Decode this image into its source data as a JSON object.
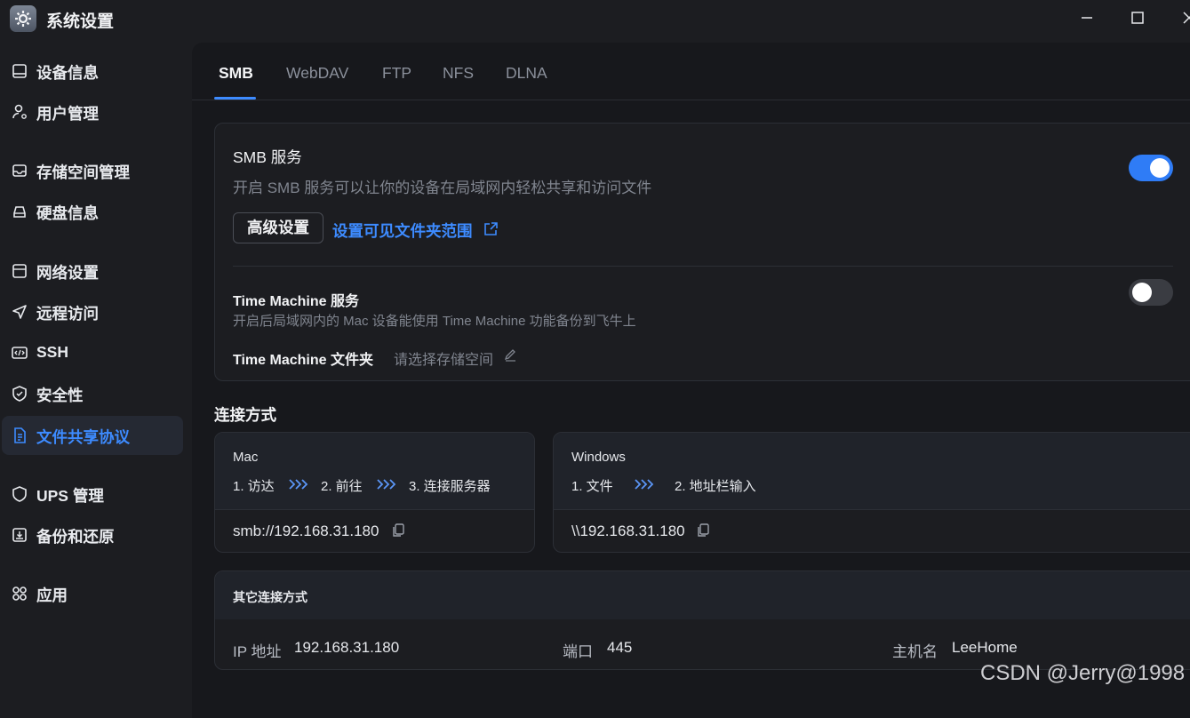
{
  "window": {
    "title": "系统设置"
  },
  "sidebar": {
    "items": [
      {
        "label": "设备信息",
        "icon": "device-info-icon"
      },
      {
        "label": "用户管理",
        "icon": "user-icon"
      },
      {
        "label": "存储空间管理",
        "icon": "storage-icon"
      },
      {
        "label": "硬盘信息",
        "icon": "disk-icon"
      },
      {
        "label": "网络设置",
        "icon": "network-icon"
      },
      {
        "label": "远程访问",
        "icon": "send-icon"
      },
      {
        "label": "SSH",
        "icon": "code-icon"
      },
      {
        "label": "安全性",
        "icon": "shield-check-icon"
      },
      {
        "label": "文件共享协议",
        "icon": "document-icon",
        "active": true
      },
      {
        "label": "UPS 管理",
        "icon": "shield-icon"
      },
      {
        "label": "备份和还原",
        "icon": "backup-icon"
      },
      {
        "label": "应用",
        "icon": "apps-icon"
      }
    ]
  },
  "tabs": [
    {
      "label": "SMB",
      "active": true
    },
    {
      "label": "WebDAV"
    },
    {
      "label": "FTP"
    },
    {
      "label": "NFS"
    },
    {
      "label": "DLNA"
    }
  ],
  "smb": {
    "title": "SMB 服务",
    "desc": "开启 SMB 服务可以让你的设备在局域网内轻松共享和访问文件",
    "enabled": true,
    "advanced_label": "高级设置",
    "visible_folders_link": "设置可见文件夹范围"
  },
  "time_machine": {
    "title": "Time Machine 服务",
    "desc": "开启后局域网内的 Mac 设备能使用 Time Machine 功能备份到飞牛上",
    "enabled": false,
    "folder_label": "Time Machine 文件夹",
    "folder_placeholder": "请选择存储空间"
  },
  "connection": {
    "section_title": "连接方式",
    "mac": {
      "title": "Mac",
      "step1": "1. 访达",
      "step2": "2. 前往",
      "step3": "3. 连接服务器",
      "address": "smb://192.168.31.180"
    },
    "windows": {
      "title": "Windows",
      "step1": "1. 文件",
      "step2": "2. 地址栏输入",
      "address": "\\\\192.168.31.180"
    },
    "other": {
      "title": "其它连接方式",
      "ip_label": "IP 地址",
      "ip_value": "192.168.31.180",
      "port_label": "端口",
      "port_value": "445",
      "host_label": "主机名",
      "host_value": "LeeHome"
    }
  },
  "watermark": "CSDN @Jerry@1998",
  "colors": {
    "accent": "#3d8bff",
    "toggle_on": "#2f7cf6",
    "toggle_off": "#3a3c42"
  }
}
